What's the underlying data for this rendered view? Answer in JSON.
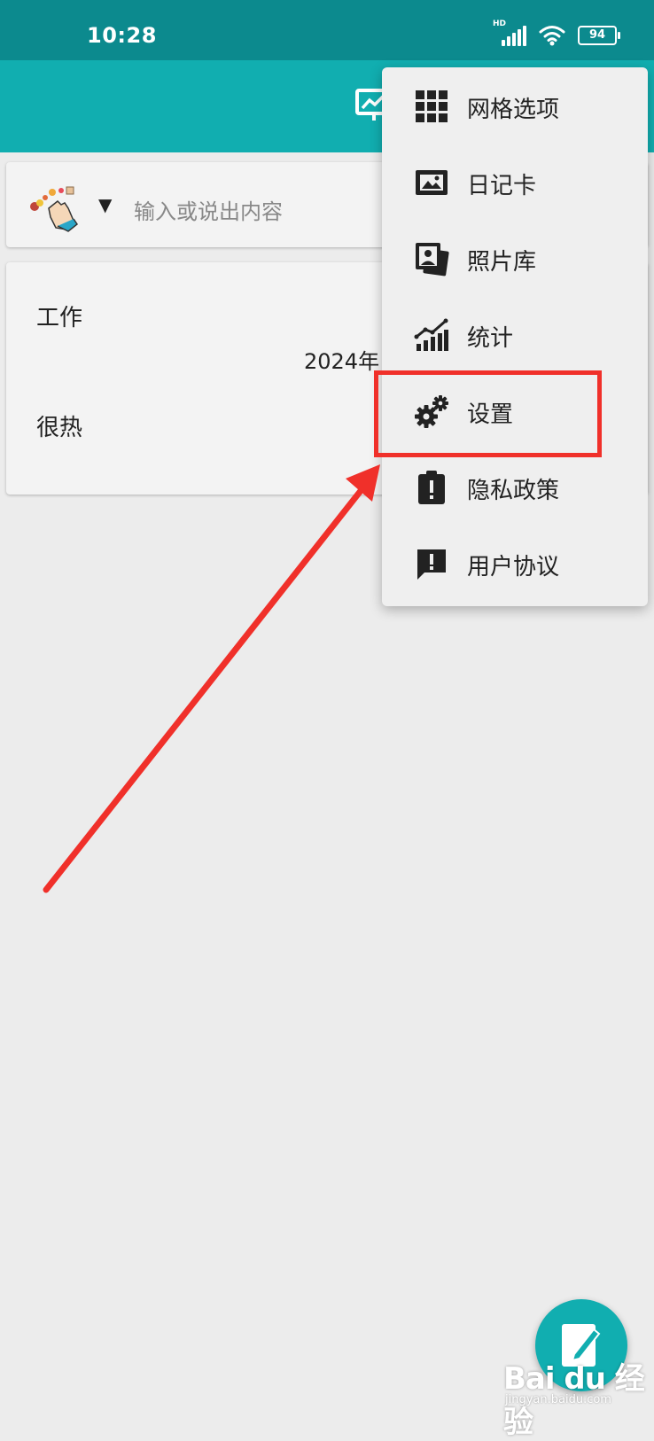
{
  "status_bar": {
    "time": "10:28",
    "network_label": "HD",
    "battery_level": "94"
  },
  "input": {
    "placeholder": "输入或说出内容",
    "dropdown_glyph": "▼"
  },
  "entry": {
    "title": "工作",
    "date": "2024年",
    "body": "很热"
  },
  "menu": {
    "items": [
      {
        "label": "网格选项",
        "icon": "grid-icon"
      },
      {
        "label": "日记卡",
        "icon": "picture-frame-icon"
      },
      {
        "label": "照片库",
        "icon": "photo-gallery-icon"
      },
      {
        "label": "统计",
        "icon": "chart-icon"
      },
      {
        "label": "设置",
        "icon": "gears-icon"
      },
      {
        "label": "隐私政策",
        "icon": "clipboard-alert-icon"
      },
      {
        "label": "用户协议",
        "icon": "message-alert-icon"
      }
    ],
    "highlighted_item": "设置"
  },
  "watermark": {
    "brand": "Bai du 经验",
    "url": "jingyan.baidu.com"
  },
  "colors": {
    "status_bar": "#0c8a8e",
    "app_bar": "#11aeb0",
    "highlight": "#f0302a",
    "background": "#ececec"
  }
}
